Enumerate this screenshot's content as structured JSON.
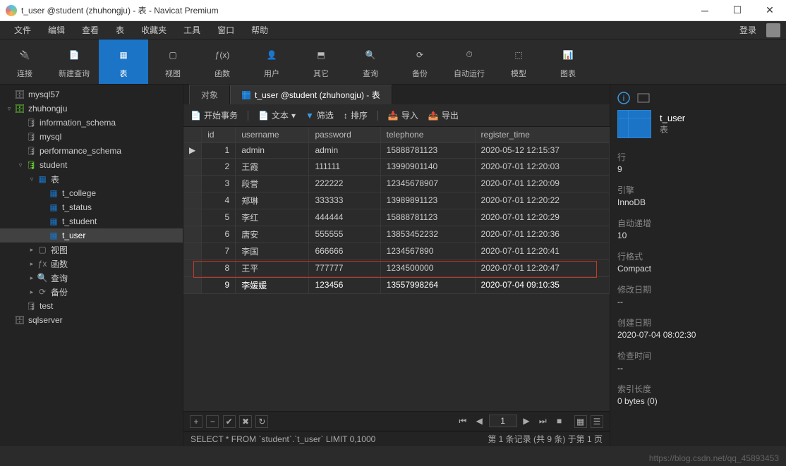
{
  "window": {
    "title": "t_user @student (zhuhongju) - 表 - Navicat Premium"
  },
  "menu": {
    "items": [
      "文件",
      "编辑",
      "查看",
      "表",
      "收藏夹",
      "工具",
      "窗口",
      "帮助"
    ],
    "login": "登录"
  },
  "toolbar": [
    {
      "key": "connect",
      "label": "连接"
    },
    {
      "key": "newquery",
      "label": "新建查询"
    },
    {
      "key": "table",
      "label": "表",
      "active": true
    },
    {
      "key": "view",
      "label": "视图"
    },
    {
      "key": "function",
      "label": "函数"
    },
    {
      "key": "user",
      "label": "用户"
    },
    {
      "key": "other",
      "label": "其它"
    },
    {
      "key": "query",
      "label": "查询"
    },
    {
      "key": "backup",
      "label": "备份"
    },
    {
      "key": "autorun",
      "label": "自动运行"
    },
    {
      "key": "model",
      "label": "模型"
    },
    {
      "key": "chart",
      "label": "图表"
    }
  ],
  "tree": [
    {
      "depth": 0,
      "tw": "",
      "icon": "server",
      "label": "mysql57"
    },
    {
      "depth": 0,
      "tw": "▿",
      "icon": "server-on",
      "label": "zhuhongju"
    },
    {
      "depth": 1,
      "tw": "",
      "icon": "db",
      "label": "information_schema"
    },
    {
      "depth": 1,
      "tw": "",
      "icon": "db",
      "label": "mysql"
    },
    {
      "depth": 1,
      "tw": "",
      "icon": "db",
      "label": "performance_schema"
    },
    {
      "depth": 1,
      "tw": "▿",
      "icon": "db-on",
      "label": "student"
    },
    {
      "depth": 2,
      "tw": "▿",
      "icon": "folder",
      "label": "表"
    },
    {
      "depth": 3,
      "tw": "",
      "icon": "table",
      "label": "t_college"
    },
    {
      "depth": 3,
      "tw": "",
      "icon": "table",
      "label": "t_status"
    },
    {
      "depth": 3,
      "tw": "",
      "icon": "table",
      "label": "t_student"
    },
    {
      "depth": 3,
      "tw": "",
      "icon": "table",
      "label": "t_user",
      "sel": true
    },
    {
      "depth": 2,
      "tw": "▸",
      "icon": "view",
      "label": "视图"
    },
    {
      "depth": 2,
      "tw": "▸",
      "icon": "fx",
      "label": "函数"
    },
    {
      "depth": 2,
      "tw": "▸",
      "icon": "query",
      "label": "查询"
    },
    {
      "depth": 2,
      "tw": "▸",
      "icon": "backup",
      "label": "备份"
    },
    {
      "depth": 1,
      "tw": "",
      "icon": "db",
      "label": "test"
    },
    {
      "depth": 0,
      "tw": "",
      "icon": "server",
      "label": "sqlserver"
    }
  ],
  "tabs": {
    "objects": "对象",
    "current": "t_user @student (zhuhongju) - 表"
  },
  "subtoolbar": {
    "begin": "开始事务",
    "text": "文本",
    "filter": "筛选",
    "sort": "排序",
    "import": "导入",
    "export": "导出"
  },
  "grid": {
    "columns": [
      "id",
      "username",
      "password",
      "telephone",
      "register_time"
    ],
    "rows": [
      {
        "id": 1,
        "username": "admin",
        "password": "admin",
        "telephone": "15888781123",
        "register_time": "2020-05-12 12:15:37",
        "mark": "▶"
      },
      {
        "id": 2,
        "username": "王霞",
        "password": "111111",
        "telephone": "13990901140",
        "register_time": "2020-07-01 12:20:03"
      },
      {
        "id": 3,
        "username": "段誉",
        "password": "222222",
        "telephone": "12345678907",
        "register_time": "2020-07-01 12:20:09"
      },
      {
        "id": 4,
        "username": "郑琳",
        "password": "333333",
        "telephone": "13989891123",
        "register_time": "2020-07-01 12:20:22"
      },
      {
        "id": 5,
        "username": "李红",
        "password": "444444",
        "telephone": "15888781123",
        "register_time": "2020-07-01 12:20:29"
      },
      {
        "id": 6,
        "username": "唐安",
        "password": "555555",
        "telephone": "13853452232",
        "register_time": "2020-07-01 12:20:36"
      },
      {
        "id": 7,
        "username": "李国",
        "password": "666666",
        "telephone": "1234567890",
        "register_time": "2020-07-01 12:20:41"
      },
      {
        "id": 8,
        "username": "王平",
        "password": "777777",
        "telephone": "1234500000",
        "register_time": "2020-07-01 12:20:47"
      },
      {
        "id": 9,
        "username": "李媛媛",
        "password": "123456",
        "telephone": "13557998264",
        "register_time": "2020-07-04 09:10:35",
        "last": true
      }
    ]
  },
  "footer": {
    "page": "1"
  },
  "status": {
    "sql": "SELECT * FROM `student`.`t_user` LIMIT 0,1000",
    "right": "第 1 条记录 (共 9 条) 于第 1 页"
  },
  "props": {
    "name": "t_user",
    "type": "表",
    "items": [
      {
        "k": "行",
        "v": "9"
      },
      {
        "k": "引擎",
        "v": "InnoDB"
      },
      {
        "k": "自动递增",
        "v": "10"
      },
      {
        "k": "行格式",
        "v": "Compact"
      },
      {
        "k": "修改日期",
        "v": "--"
      },
      {
        "k": "创建日期",
        "v": "2020-07-04 08:02:30"
      },
      {
        "k": "检查时间",
        "v": "--"
      },
      {
        "k": "索引长度",
        "v": "0 bytes (0)"
      }
    ]
  },
  "watermark": "https://blog.csdn.net/qq_45893453"
}
